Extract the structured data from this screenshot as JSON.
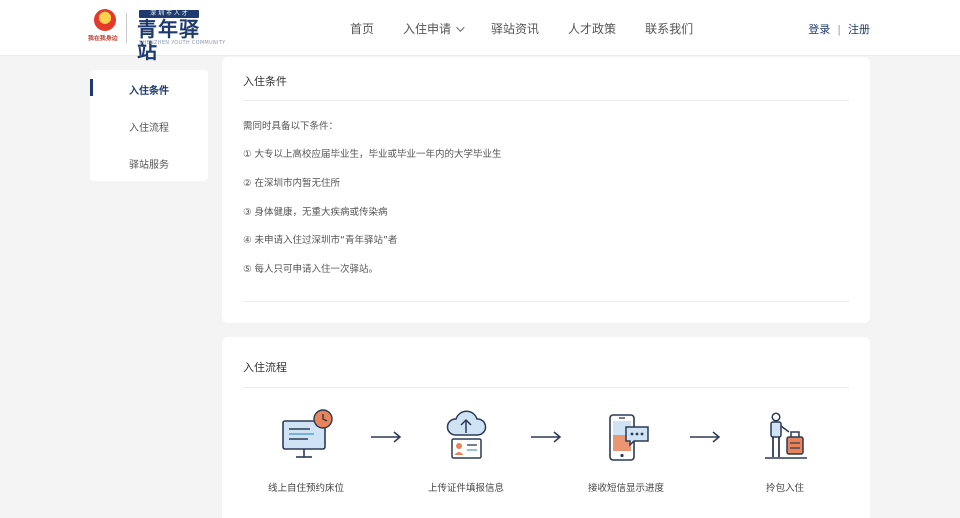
{
  "header": {
    "emblem_text": "我在我身边",
    "brand_tag": "深 圳 市 人 才",
    "brand_name": "青年驿站",
    "brand_sub": "SHENZHEN YOUTH COMMUNITY",
    "nav": [
      {
        "label": "首页"
      },
      {
        "label": "入住申请",
        "has_dropdown": true
      },
      {
        "label": "驿站资讯"
      },
      {
        "label": "人才政策"
      },
      {
        "label": "联系我们"
      }
    ],
    "login": "登录",
    "separator": "|",
    "register": "注册"
  },
  "sidebar": {
    "items": [
      {
        "label": "入住条件",
        "active": true
      },
      {
        "label": "入住流程"
      },
      {
        "label": "驿站服务"
      }
    ]
  },
  "conditions": {
    "title": "入住条件",
    "intro": "需同时具备以下条件：",
    "items": [
      "① 大专以上高校应届毕业生，毕业或毕业一年内的大学毕业生",
      "② 在深圳市内暂无住所",
      "③ 身体健康，无重大疾病或传染病",
      "④ 未申请入住过深圳市“青年驿站”者",
      "⑤ 每人只可申请入住一次驿站。"
    ]
  },
  "process": {
    "title": "入住流程",
    "steps": [
      {
        "label": "线上自住预约床位",
        "icon": "monitor-clock-icon"
      },
      {
        "label": "上传证件填报信息",
        "icon": "cloud-upload-id-icon"
      },
      {
        "label": "接收短信显示进度",
        "icon": "phone-message-icon"
      },
      {
        "label": "拎包入住",
        "icon": "person-luggage-icon"
      }
    ]
  },
  "colors": {
    "brand": "#1e3a6e",
    "icon_blue": "#5a9fd4",
    "icon_orange": "#e8845a"
  }
}
